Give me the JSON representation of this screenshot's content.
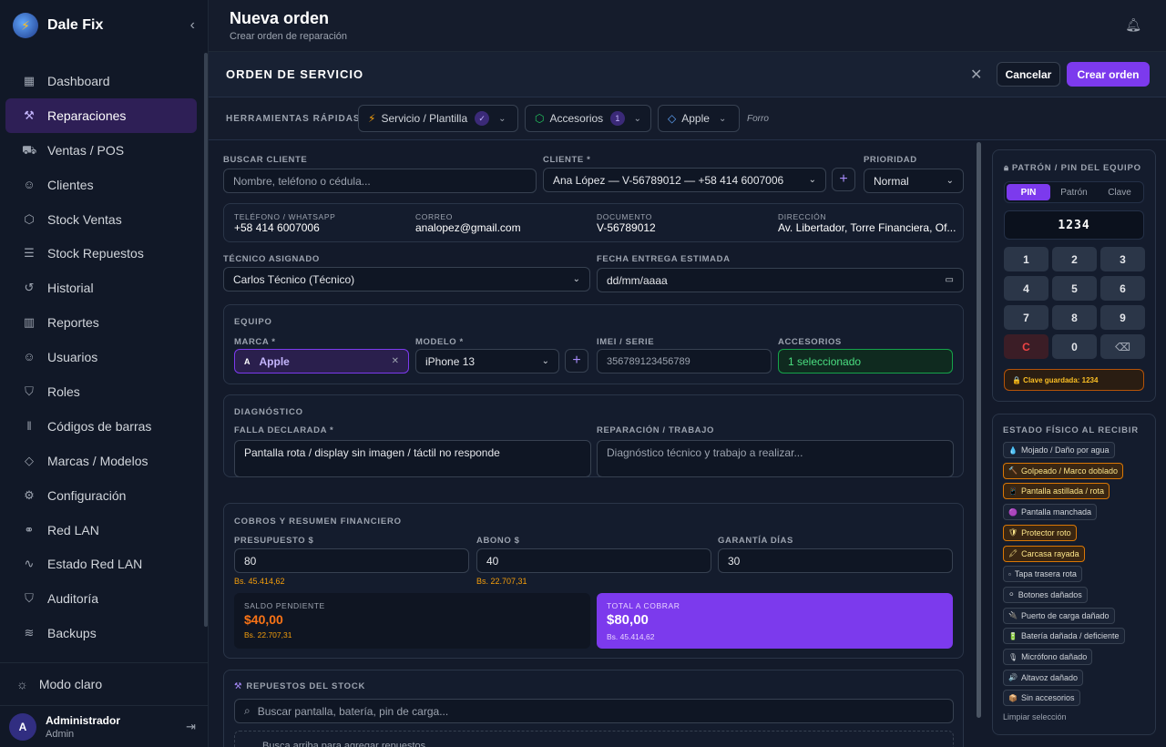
{
  "app": {
    "name": "Dale Fix"
  },
  "sidebar": {
    "items": [
      {
        "label": "Dashboard",
        "icon": "dashboard-icon",
        "glyph": "▦"
      },
      {
        "label": "Reparaciones",
        "icon": "wrench-icon",
        "glyph": "⚒"
      },
      {
        "label": "Ventas / POS",
        "icon": "cart-icon",
        "glyph": "⛟"
      },
      {
        "label": "Clientes",
        "icon": "users-icon",
        "glyph": "☺"
      },
      {
        "label": "Stock Ventas",
        "icon": "box-icon",
        "glyph": "⬡"
      },
      {
        "label": "Stock Repuestos",
        "icon": "sliders-icon",
        "glyph": "☰"
      },
      {
        "label": "Historial",
        "icon": "history-icon",
        "glyph": "↺"
      },
      {
        "label": "Reportes",
        "icon": "chart-icon",
        "glyph": "▥"
      },
      {
        "label": "Usuarios",
        "icon": "user-group-icon",
        "glyph": "☺"
      },
      {
        "label": "Roles",
        "icon": "shield-icon",
        "glyph": "⛉"
      },
      {
        "label": "Códigos de barras",
        "icon": "barcode-icon",
        "glyph": "‖"
      },
      {
        "label": "Marcas / Modelos",
        "icon": "tag-icon",
        "glyph": "◇"
      },
      {
        "label": "Configuración",
        "icon": "gear-icon",
        "glyph": "⚙"
      },
      {
        "label": "Red LAN",
        "icon": "network-icon",
        "glyph": "⚭"
      },
      {
        "label": "Estado Red LAN",
        "icon": "activity-icon",
        "glyph": "∿"
      },
      {
        "label": "Auditoría",
        "icon": "shield-check-icon",
        "glyph": "⛉"
      },
      {
        "label": "Backups",
        "icon": "database-icon",
        "glyph": "≋"
      }
    ],
    "active_index": 1,
    "mode_label": "Modo claro",
    "user": {
      "initial": "A",
      "name": "Administrador",
      "role": "Admin"
    }
  },
  "header": {
    "title": "Nueva orden",
    "subtitle": "Crear orden de reparación"
  },
  "panel": {
    "title": "ORDEN DE SERVICIO",
    "cancel": "Cancelar",
    "create": "Crear orden"
  },
  "tools": {
    "label": "HERRAMIENTAS RÁPIDAS:",
    "service": "Servicio / Plantilla",
    "service_badge": "✓",
    "accessories": "Accesorios",
    "accessories_badge": "1",
    "brand": "Apple",
    "forro": "Forro"
  },
  "client": {
    "search_label": "BUSCAR CLIENTE",
    "search_placeholder": "Nombre, teléfono o cédula...",
    "client_label": "CLIENTE *",
    "client_value": "Ana López — V-56789012 — +58 414 6007006",
    "priority_label": "PRIORIDAD",
    "priority_value": "Normal",
    "phone_label": "TELÉFONO / WHATSAPP",
    "phone": "+58 414 6007006",
    "email_label": "CORREO",
    "email": "analopez@gmail.com",
    "doc_label": "DOCUMENTO",
    "doc": "V-56789012",
    "address_label": "DIRECCIÓN",
    "address": "Av. Libertador, Torre Financiera, Of..."
  },
  "assign": {
    "tech_label": "TÉCNICO ASIGNADO",
    "tech_value": "Carlos Técnico (Técnico)",
    "date_label": "FECHA ENTREGA ESTIMADA",
    "date_value": "dd/mm/aaaa"
  },
  "equipment": {
    "title": "EQUIPO",
    "brand_label": "MARCA *",
    "brand_value": "Apple",
    "brand_initial": "A",
    "model_label": "MODELO *",
    "model_value": "iPhone 13",
    "imei_label": "IMEI / SERIE",
    "imei_value": "356789123456789",
    "acc_label": "ACCESORIOS",
    "acc_value": "1 seleccionado"
  },
  "diagnosis": {
    "title": "DIAGNÓSTICO",
    "fault_label": "FALLA DECLARADA *",
    "fault_value": "Pantalla rota / display sin imagen / táctil no responde",
    "repair_label": "REPARACIÓN / TRABAJO",
    "repair_placeholder": "Diagnóstico técnico y trabajo a realizar..."
  },
  "finance": {
    "title": "COBROS Y RESUMEN FINANCIERO",
    "budget_label": "PRESUPUESTO $",
    "budget_value": "80",
    "budget_bs": "Bs. 45.414,62",
    "deposit_label": "ABONO $",
    "deposit_value": "40",
    "deposit_bs": "Bs. 22.707,31",
    "warranty_label": "GARANTÍA DÍAS",
    "warranty_value": "30",
    "pending_label": "SALDO PENDIENTE",
    "pending_value": "$40,00",
    "pending_bs": "Bs. 22.707,31",
    "total_label": "TOTAL A COBRAR",
    "total_value": "$80,00",
    "total_bs": "Bs. 45.414,62"
  },
  "parts": {
    "title": "REPUESTOS DEL STOCK",
    "search_placeholder": "Buscar pantalla, batería, pin de carga...",
    "hint": "Busca arriba para agregar repuestos"
  },
  "pin": {
    "title": "PATRÓN / PIN DEL EQUIPO",
    "tabs": [
      "PIN",
      "Patrón",
      "Clave"
    ],
    "display": "1234",
    "keys": [
      "1",
      "2",
      "3",
      "4",
      "5",
      "6",
      "7",
      "8",
      "9",
      "C",
      "0",
      "⌫"
    ],
    "saved": "🔒 Clave guardada: 1234"
  },
  "physical": {
    "title": "ESTADO FÍSICO AL RECIBIR",
    "tags": [
      {
        "label": "Mojado / Daño por agua",
        "icon": "💧",
        "selected": false
      },
      {
        "label": "Golpeado / Marco doblado",
        "icon": "🔨",
        "selected": true
      },
      {
        "label": "Pantalla astillada / rota",
        "icon": "📱",
        "selected": true
      },
      {
        "label": "Pantalla manchada",
        "icon": "🟣",
        "selected": false
      },
      {
        "label": "Protector roto",
        "icon": "🛡",
        "selected": true
      },
      {
        "label": "Carcasa rayada",
        "icon": "🖍",
        "selected": true
      },
      {
        "label": "Tapa trasera rota",
        "icon": "▫",
        "selected": false
      },
      {
        "label": "Botones dañados",
        "icon": "⚪",
        "selected": false
      },
      {
        "label": "Puerto de carga dañado",
        "icon": "🔌",
        "selected": false
      },
      {
        "label": "Batería dañada / deficiente",
        "icon": "🔋",
        "selected": false
      },
      {
        "label": "Micrófono dañado",
        "icon": "🎙",
        "selected": false
      },
      {
        "label": "Altavoz dañado",
        "icon": "🔊",
        "selected": false
      },
      {
        "label": "Sin accesorios",
        "icon": "📦",
        "selected": false
      }
    ],
    "clear": "Limpiar selección"
  }
}
